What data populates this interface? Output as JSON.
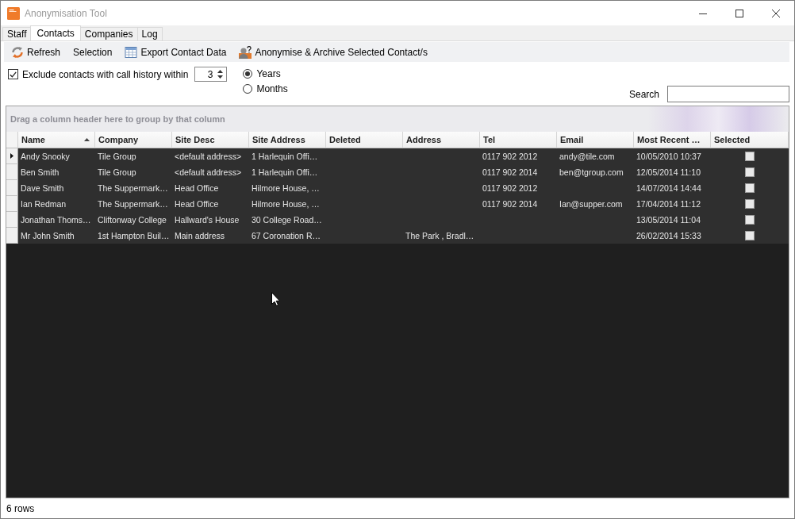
{
  "window": {
    "title": "Anonymisation Tool"
  },
  "tabs": [
    {
      "label": "Staff",
      "selected": false
    },
    {
      "label": "Contacts",
      "selected": true
    },
    {
      "label": "Companies",
      "selected": false
    },
    {
      "label": "Log",
      "selected": false
    }
  ],
  "toolbar": [
    {
      "label": "Refresh",
      "kind": "refresh"
    },
    {
      "label": "Selection",
      "kind": "menu"
    },
    {
      "label": "Export Contact Data",
      "kind": "export"
    },
    {
      "label": "Anonymise & Archive Selected Contact/s",
      "kind": "anonymise"
    }
  ],
  "options": {
    "exclude_history": {
      "label": "Exclude contacts with call history within",
      "checked": true,
      "value": "3"
    },
    "period": [
      {
        "label": "Years",
        "selected": true
      },
      {
        "label": "Months",
        "selected": false
      }
    ]
  },
  "search": {
    "label": "Search"
  },
  "grid": {
    "group_hint": "Drag a column header here to group by that column",
    "columns": [
      {
        "label": "Name",
        "kind": "text",
        "sorted": true
      },
      {
        "label": "Company",
        "kind": "text",
        "sorted": false
      },
      {
        "label": "Site Desc",
        "kind": "text",
        "sorted": false
      },
      {
        "label": "Site Address",
        "kind": "text",
        "sorted": false
      },
      {
        "label": "Deleted",
        "kind": "text",
        "sorted": false
      },
      {
        "label": "Address",
        "kind": "text",
        "sorted": false
      },
      {
        "label": "Tel",
        "kind": "text",
        "sorted": false
      },
      {
        "label": "Email",
        "kind": "text",
        "sorted": false
      },
      {
        "label": "Most Recent …",
        "kind": "text",
        "sorted": false
      },
      {
        "label": "Selected",
        "kind": "checkbox",
        "sorted": false
      }
    ],
    "rows": [
      {
        "selected": true,
        "name": "Andy Snooky",
        "company": "Tile Group",
        "site_desc": "<default address>",
        "site_address": "1 Harlequin Offi…",
        "tel": "0117 902 2012",
        "email": "andy@tile.com",
        "most_recent": "10/05/2010 10:37",
        "checked": false
      },
      {
        "selected": false,
        "name": "Ben Smith",
        "company": "Tile Group",
        "site_desc": "<default address>",
        "site_address": "1 Harlequin Offi…",
        "tel": "0117 902 2014",
        "email": "ben@tgroup.com",
        "most_recent": "12/05/2014 11:10",
        "checked": false
      },
      {
        "selected": false,
        "name": "Dave Smith",
        "company": "The Suppermark…",
        "site_desc": "Head Office",
        "site_address": "Hilmore House, …",
        "tel": "0117 902 2012",
        "most_recent": "14/07/2014 14:44",
        "checked": false
      },
      {
        "selected": false,
        "name": "Ian Redman",
        "company": "The Suppermark…",
        "site_desc": "Head Office",
        "site_address": "Hilmore House, …",
        "tel": "0117 902 2014",
        "email": "Ian@supper.com",
        "most_recent": "17/04/2014 11:12",
        "checked": false
      },
      {
        "selected": false,
        "name": "Jonathan Thoms…",
        "company": "Cliftonway College",
        "site_desc": "Hallward's House",
        "site_address": "30 College Road…",
        "most_recent": "13/05/2014 11:04",
        "checked": false
      },
      {
        "selected": false,
        "name": "Mr John Smith",
        "company": "1st Hampton Buil…",
        "site_desc": "Main address",
        "site_address": "67 Coronation R…",
        "address": "The Park , Bradl…",
        "most_recent": "26/02/2014 15:33",
        "checked": false
      }
    ]
  },
  "status_bar": {
    "text": "6 rows"
  }
}
